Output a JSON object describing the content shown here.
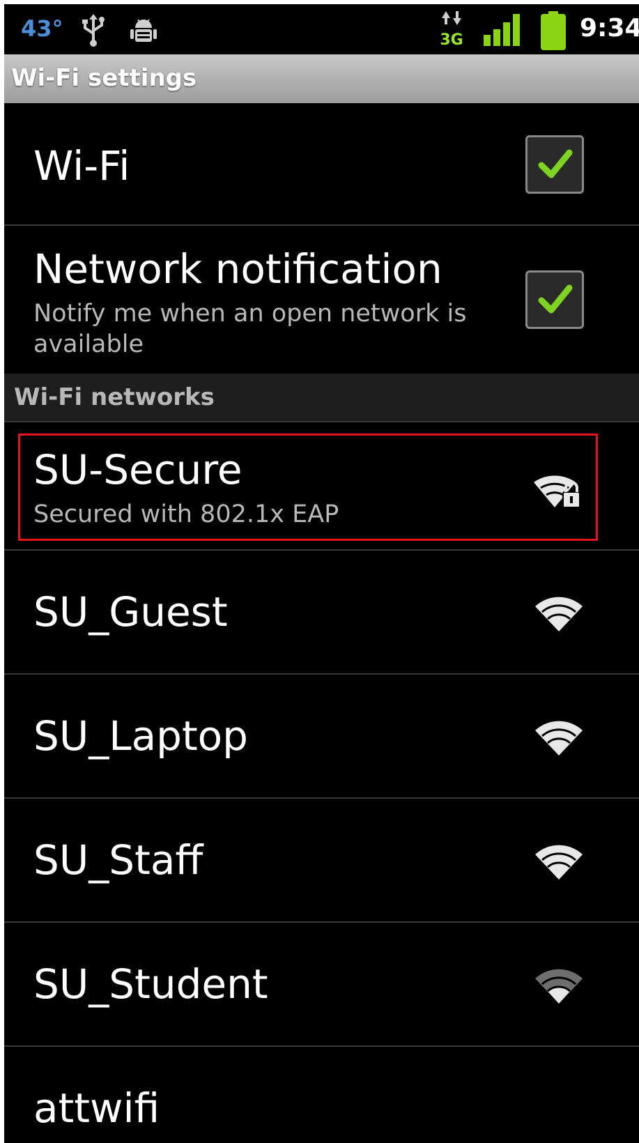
{
  "status_bar": {
    "temperature": "43°",
    "network_type": "3G",
    "time": "9:34",
    "icons": [
      "usb-icon",
      "android-debug-icon",
      "data-3g-icon",
      "signal-strength-icon",
      "battery-icon"
    ]
  },
  "title_bar": {
    "title": "Wi-Fi settings"
  },
  "settings": {
    "wifi": {
      "label": "Wi-Fi",
      "checked": true
    },
    "network_notification": {
      "label": "Network notification",
      "summary": "Notify me when an open network is available",
      "checked": true
    }
  },
  "section_header": "Wi-Fi networks",
  "networks": [
    {
      "ssid": "SU-Secure",
      "summary": "Secured with 802.1x EAP",
      "icon": "wifi-secured-icon",
      "highlighted": true
    },
    {
      "ssid": "SU_Guest",
      "icon": "wifi-icon"
    },
    {
      "ssid": "SU_Laptop",
      "icon": "wifi-icon"
    },
    {
      "ssid": "SU_Staff",
      "icon": "wifi-icon"
    },
    {
      "ssid": "SU_Student",
      "icon": "wifi-weak-icon"
    },
    {
      "ssid": "attwifi",
      "icon": "wifi-icon"
    }
  ],
  "colors": {
    "highlight_border": "#e8141c",
    "check_green": "#7ed321",
    "temperature_blue": "#4a8fd8",
    "battery_green": "#8ad414"
  }
}
